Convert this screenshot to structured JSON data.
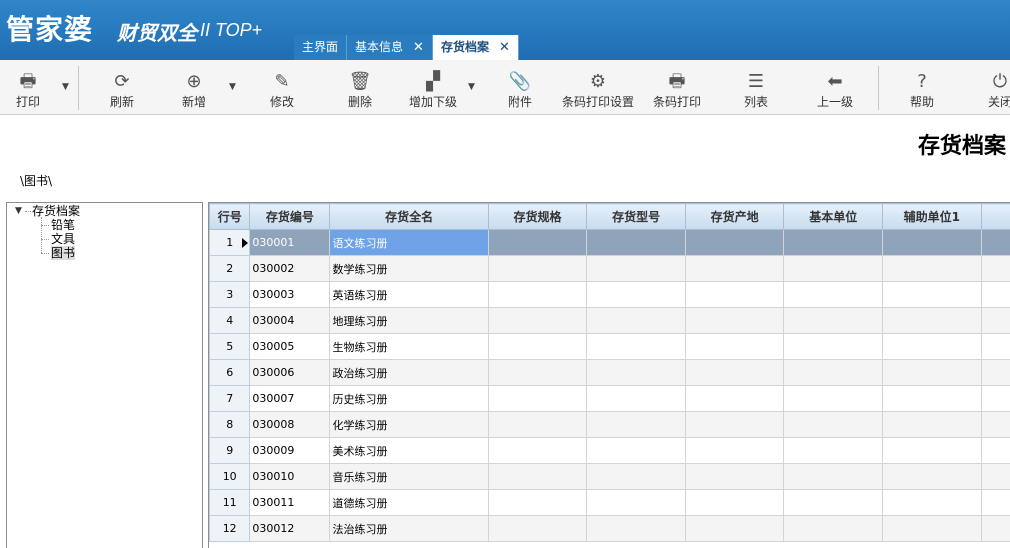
{
  "app": {
    "logo_main": "管家婆",
    "logo_sub": "财贸双全",
    "logo_version": "II TOP+"
  },
  "tabs": [
    {
      "label": "主界面",
      "closable": false,
      "active": false
    },
    {
      "label": "基本信息",
      "closable": true,
      "active": false
    },
    {
      "label": "存货档案",
      "closable": true,
      "active": true
    }
  ],
  "toolbar": {
    "print": "打印",
    "refresh": "刷新",
    "add": "新增",
    "edit": "修改",
    "delete": "删除",
    "add_child": "增加下级",
    "attachment": "附件",
    "barcode_settings": "条码打印设置",
    "barcode_print": "条码打印",
    "columns": "列表",
    "up_level": "上一级",
    "help": "帮助",
    "close": "关闭"
  },
  "page": {
    "title": "存货档案",
    "path": "\\图书\\"
  },
  "tree": {
    "root": "存货档案",
    "children": [
      "铅笔",
      "文具",
      "图书"
    ],
    "selected": "图书"
  },
  "grid": {
    "columns": [
      "行号",
      "存货编号",
      "存货全名",
      "存货规格",
      "存货型号",
      "存货产地",
      "基本单位",
      "辅助单位1"
    ],
    "rows": [
      {
        "no": "1",
        "code": "030001",
        "name": "语文练习册"
      },
      {
        "no": "2",
        "code": "030002",
        "name": "数学练习册"
      },
      {
        "no": "3",
        "code": "030003",
        "name": "英语练习册"
      },
      {
        "no": "4",
        "code": "030004",
        "name": "地理练习册"
      },
      {
        "no": "5",
        "code": "030005",
        "name": "生物练习册"
      },
      {
        "no": "6",
        "code": "030006",
        "name": "政治练习册"
      },
      {
        "no": "7",
        "code": "030007",
        "name": "历史练习册"
      },
      {
        "no": "8",
        "code": "030008",
        "name": "化学练习册"
      },
      {
        "no": "9",
        "code": "030009",
        "name": "美术练习册"
      },
      {
        "no": "10",
        "code": "030010",
        "name": "音乐练习册"
      },
      {
        "no": "11",
        "code": "030011",
        "name": "道德练习册"
      },
      {
        "no": "12",
        "code": "030012",
        "name": "法治练习册"
      }
    ]
  },
  "colors": {
    "title_bar": "#2f86c9",
    "header_bg": "#c7dbee",
    "selected_row": "#8fa4bb",
    "selected_cell": "#6fa3e8"
  }
}
